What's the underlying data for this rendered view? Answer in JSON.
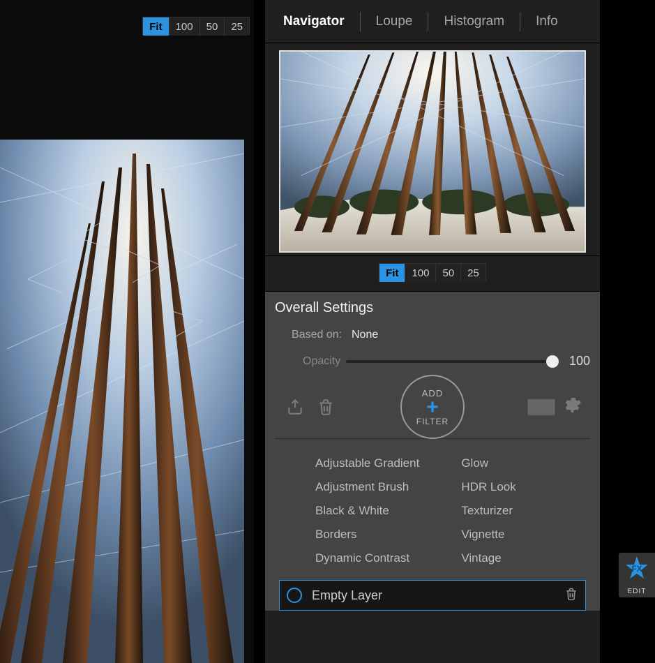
{
  "zoom": {
    "options": [
      "Fit",
      "100",
      "50",
      "25"
    ],
    "main_active": "Fit",
    "nav_active": "Fit"
  },
  "panel_tabs": {
    "items": [
      "Navigator",
      "Loupe",
      "Histogram",
      "Info"
    ],
    "active": "Navigator"
  },
  "settings": {
    "title": "Overall Settings",
    "based_on_label": "Based on:",
    "based_on_value": "None",
    "opacity_label": "Opacity",
    "opacity_value": "100"
  },
  "add_filter": {
    "line1": "ADD",
    "plus": "+",
    "line2": "FILTER"
  },
  "filters": {
    "col1": [
      "Adjustable Gradient",
      "Adjustment Brush",
      "Black & White",
      "Borders",
      "Dynamic Contrast"
    ],
    "col2": [
      "Glow",
      "HDR Look",
      "Texturizer",
      "Vignette",
      "Vintage"
    ]
  },
  "layer": {
    "name": "Empty Layer"
  },
  "dock": {
    "label": "EDIT"
  },
  "colors": {
    "accent": "#2b93e2",
    "panel": "#444444",
    "dark": "#1f1f1f"
  }
}
